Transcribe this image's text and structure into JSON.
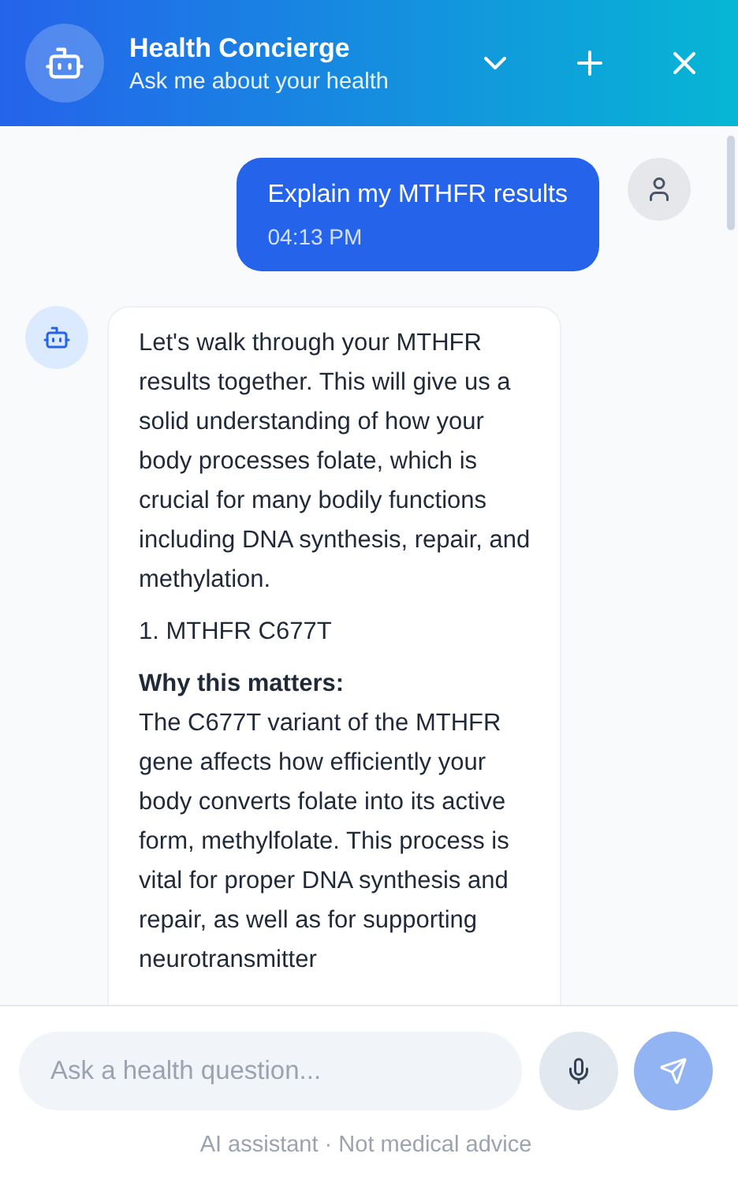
{
  "header": {
    "title": "Health Concierge",
    "subtitle": "Ask me about your health"
  },
  "messages": [
    {
      "kind": "user",
      "text": "Explain my MTHFR results",
      "time": "04:13 PM"
    },
    {
      "kind": "bot",
      "blocks": [
        {
          "kind": "paragraph",
          "text": "Let's walk through your MTHFR results together. This will give us a solid understanding of how your body processes folate, which is crucial for many bodily functions including DNA synthesis, repair, and methylation."
        },
        {
          "kind": "heading",
          "text": "1. MTHFR C677T"
        },
        {
          "kind": "label",
          "text": "Why this matters:"
        },
        {
          "kind": "paragraph",
          "text": "The C677T variant of the MTHFR gene affects how efficiently your body converts folate into its active form, methylfolate. This process is vital for proper DNA synthesis and repair, as well as for supporting neurotransmitter"
        }
      ]
    }
  ],
  "composer": {
    "placeholder": "Ask a health question...",
    "send_disabled": true
  },
  "disclaimer": "AI assistant · Not medical advice"
}
